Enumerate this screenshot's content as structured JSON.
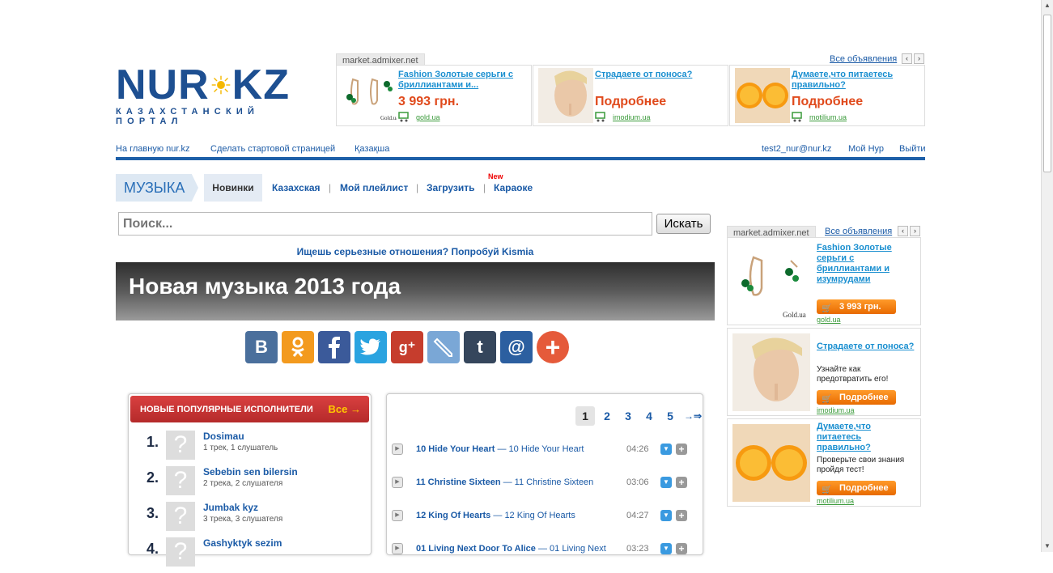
{
  "logo": {
    "part1": "NUR",
    "part2": "KZ",
    "subtitle": "КАЗАХСТАНСКИЙ ПОРТАЛ"
  },
  "top_ads": {
    "source": "market.admixer.net",
    "all_link": "Все объявления",
    "items": [
      {
        "title": "Fashion Золотые серьги с бриллиантами и...",
        "price": "3 993 грн.",
        "domain": "gold.ua",
        "brand": "Gold.ua"
      },
      {
        "title": "Страдаете от поноса?",
        "price": "Подробнее",
        "domain": "imodium.ua"
      },
      {
        "title": "Думаете,что питаетесь правильно?",
        "price": "Подробнее",
        "domain": "motilium.ua"
      }
    ]
  },
  "topnav": {
    "home": "На главную nur.kz",
    "start_page": "Сделать стартовой страницей",
    "kazakh": "Қазақша",
    "email": "test2_nur@nur.kz",
    "my_nur": "Мой Нур",
    "logout": "Выйти"
  },
  "music_nav": {
    "section": "МУЗЫКА",
    "tabs": [
      "Новинки",
      "Казахская",
      "Мой плейлист",
      "Загрузить",
      "Караоке"
    ],
    "new_badge": "New",
    "separator": "|"
  },
  "search": {
    "placeholder": "Поиск...",
    "button": "Искать"
  },
  "promo": "Ищешь серьезные отношения? Попробуй Kismia",
  "banner_title": "Новая музыка 2013 года",
  "social": {
    "vk": "В",
    "plus": "+",
    "mail": "@",
    "tumblr": "t"
  },
  "artists": {
    "heading": "НОВЫЕ ПОПУЛЯРНЫЕ ИСПОЛНИТЕЛИ",
    "all": "Все →",
    "placeholder": "?",
    "items": [
      {
        "rank": "1.",
        "name": "Dosimau",
        "stats": "1 трек, 1 слушатель"
      },
      {
        "rank": "2.",
        "name": "Sebebin sen bilersin",
        "stats": "2 трека, 2 слушателя"
      },
      {
        "rank": "3.",
        "name": "Jumbak kyz",
        "stats": "3 трека, 3 слушателя"
      },
      {
        "rank": "4.",
        "name": "Gashyktyk sezim",
        "stats": ""
      }
    ]
  },
  "pagination": {
    "pages": [
      "1",
      "2",
      "3",
      "4",
      "5"
    ],
    "next": "→⇒"
  },
  "tracks": [
    {
      "artist": "10 Hide Your Heart",
      "sep": " — ",
      "title": "10 Hide Your Heart",
      "duration": "04:26"
    },
    {
      "artist": "11 Christine Sixteen",
      "sep": " — ",
      "title": "11 Christine Sixteen",
      "duration": "03:06"
    },
    {
      "artist": "12 King Of Hearts",
      "sep": " — ",
      "title": "12 King Of Hearts",
      "duration": "04:27"
    },
    {
      "artist": "01 Living Next Door To Alice",
      "sep": " — ",
      "title": "01 Living Next",
      "duration": "03:23"
    }
  ],
  "right_ads": {
    "source": "market.admixer.net",
    "all_link": "Все объявления",
    "items": [
      {
        "title": "Fashion Золотые серьги с бриллиантами и изумрудами",
        "desc": "",
        "button": "3 993 грн.",
        "domain": "gold.ua",
        "brand": "Gold.ua"
      },
      {
        "title": "Страдаете от поноса?",
        "desc": "Узнайте как предотвратить его!",
        "button": "Подробнее",
        "domain": "imodium.ua"
      },
      {
        "title": "Думаете,что питаетесь правильно?",
        "desc": "Проверьте свои знания пройдя тест!",
        "button": "Подробнее",
        "domain": "motilium.ua"
      }
    ]
  },
  "colors": {
    "brand": "#1d4f91",
    "link": "#1a5aa6",
    "accent_orange": "#e86a00",
    "red_header": "#c33333"
  }
}
